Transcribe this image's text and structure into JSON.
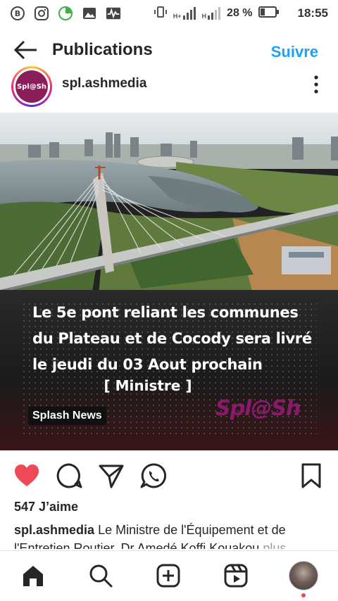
{
  "status_bar": {
    "battery_percent": "28 %",
    "time": "18:55",
    "network_1": "H+",
    "network_2": "H",
    "icons": [
      "b-circle-icon",
      "instagram-icon",
      "data-saver-icon",
      "image-icon",
      "activity-icon",
      "vibrate-icon",
      "signal-icon",
      "signal-icon",
      "battery-icon"
    ]
  },
  "header": {
    "title": "Publications",
    "follow_label": "Suivre"
  },
  "post": {
    "username": "spl.ashmedia",
    "avatar_text": "Spl@Sh",
    "image": {
      "headline": "Le 5e pont reliant les communes du Plateau et de Cocody sera  livré le jeudi du 03 Aout prochain",
      "attribution": "[ Ministre ]",
      "tag": "Splash News",
      "logo_text": "Spl@Sh"
    },
    "likes": "547 J’aime",
    "caption_user": "spl.ashmedia",
    "caption_text": "Le Ministre de l'Équipement et de l'Entretien Routier, Dr Amedé Koffi Kouakou",
    "caption_more": "plus"
  },
  "colors": {
    "accent": "#1da1f2",
    "like": "#ed4956",
    "brand": "#8a1d5a"
  }
}
